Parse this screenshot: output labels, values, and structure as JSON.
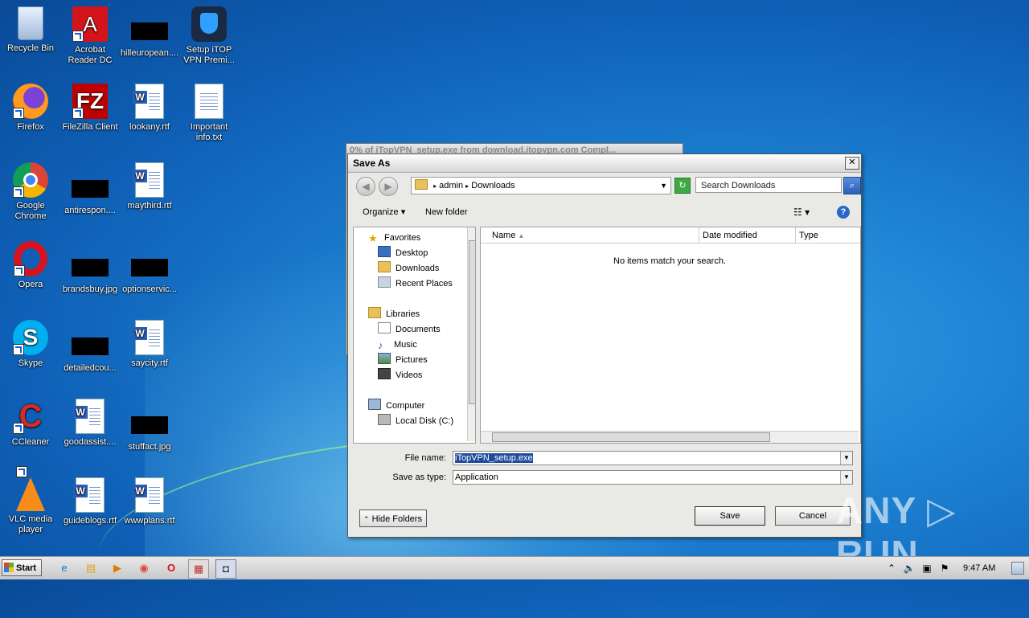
{
  "desktop": {
    "icons": [
      {
        "label": "Recycle Bin",
        "icon": "recycle-bin-icon"
      },
      {
        "label": "Acrobat Reader DC",
        "icon": "acrobat-icon"
      },
      {
        "label": "hilleuropean....",
        "icon": "redacted-thumbnail"
      },
      {
        "label": "Setup iTOP VPN Premi...",
        "icon": "itop-vpn-icon"
      },
      {
        "label": "Firefox",
        "icon": "firefox-icon"
      },
      {
        "label": "FileZilla Client",
        "icon": "filezilla-icon"
      },
      {
        "label": "lookany.rtf",
        "icon": "word-doc-icon"
      },
      {
        "label": "Important info.txt",
        "icon": "text-file-icon"
      },
      {
        "label": "Google Chrome",
        "icon": "chrome-icon"
      },
      {
        "label": "antirespon....",
        "icon": "redacted-thumbnail"
      },
      {
        "label": "maythird.rtf",
        "icon": "word-doc-icon"
      },
      {
        "label": "Opera",
        "icon": "opera-icon"
      },
      {
        "label": "brandsbuy.jpg",
        "icon": "redacted-thumbnail"
      },
      {
        "label": "optionservic...",
        "icon": "redacted-thumbnail"
      },
      {
        "label": "Skype",
        "icon": "skype-icon"
      },
      {
        "label": "detailedcou...",
        "icon": "redacted-thumbnail"
      },
      {
        "label": "saycity.rtf",
        "icon": "word-doc-icon"
      },
      {
        "label": "CCleaner",
        "icon": "ccleaner-icon"
      },
      {
        "label": "goodassist....",
        "icon": "word-doc-icon"
      },
      {
        "label": "stuffact.jpg",
        "icon": "redacted-thumbnail"
      },
      {
        "label": "VLC media player",
        "icon": "vlc-icon"
      },
      {
        "label": "guideblogs.rtf",
        "icon": "word-doc-icon"
      },
      {
        "label": "wwwplans.rtf",
        "icon": "word-doc-icon"
      }
    ]
  },
  "background_dialog": {
    "title": "0% of iTopVPN_setup.exe from download.itopvpn.com Compl..."
  },
  "save_as": {
    "title": "Save As",
    "close": "✕",
    "address": {
      "root": "admin",
      "folder": "Downloads"
    },
    "search_placeholder": "Search Downloads",
    "toolbar": {
      "organize": "Organize ▾",
      "new_folder": "New folder"
    },
    "nav": {
      "favorites": "Favorites",
      "desktop": "Desktop",
      "downloads": "Downloads",
      "recent": "Recent Places",
      "libraries": "Libraries",
      "documents": "Documents",
      "music": "Music",
      "pictures": "Pictures",
      "videos": "Videos",
      "computer": "Computer",
      "local_disk": "Local Disk (C:)"
    },
    "columns": {
      "name": "Name",
      "date": "Date modified",
      "type": "Type"
    },
    "empty_message": "No items match your search.",
    "file_name_label": "File name:",
    "file_name_value": "iTopVPN_setup.exe",
    "save_as_type_label": "Save as type:",
    "save_as_type_value": "Application",
    "hide_folders": "Hide Folders",
    "save_button": "Save",
    "cancel_button": "Cancel"
  },
  "taskbar": {
    "start": "Start",
    "time": "9:47 AM"
  },
  "watermark": "ANY ▷ RUN"
}
